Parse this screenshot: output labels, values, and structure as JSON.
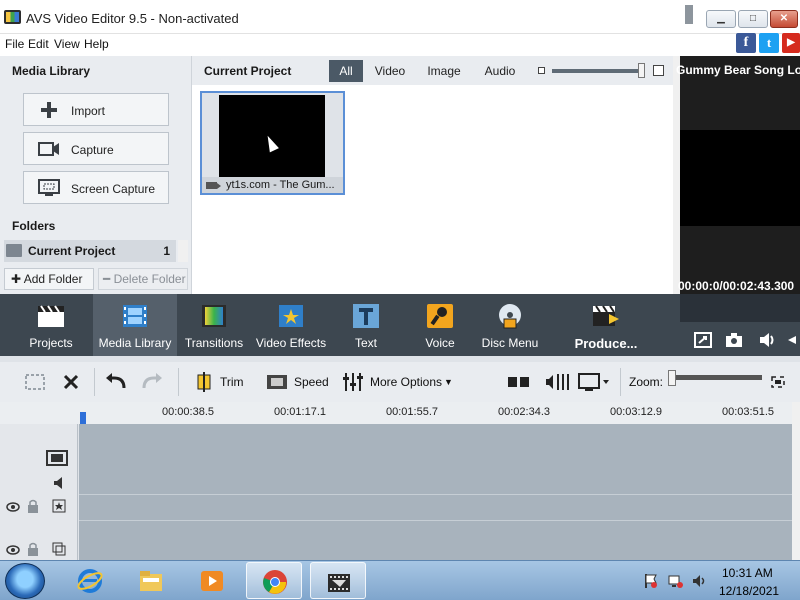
{
  "window": {
    "title": "AVS Video Editor 9.5 - Non-activated",
    "minimize": "▁",
    "maximize": "□",
    "close": "✕"
  },
  "menu": [
    "File",
    "Edit",
    "View",
    "Help"
  ],
  "social": {
    "facebook": "f",
    "twitter": "t",
    "youtube": "▶"
  },
  "media_library": {
    "heading": "Media Library",
    "buttons": [
      "Import",
      "Capture",
      "Screen Capture"
    ],
    "folders_heading": "Folders",
    "folder": {
      "name": "Current Project",
      "count": "1"
    },
    "add_folder": "Add Folder",
    "delete_folder": "Delete Folder"
  },
  "project": {
    "heading": "Current Project",
    "filters": [
      "All",
      "Video",
      "Image",
      "Audio"
    ],
    "active_filter": "All",
    "items": [
      {
        "caption": "yt1s.com - The Gum..."
      }
    ]
  },
  "preview": {
    "title": "Gummy Bear Song  Lor",
    "time": "00:00:0­/00:02:43.300"
  },
  "toolbar": {
    "items": [
      "Projects",
      "Media Library",
      "Transitions",
      "Video Effects",
      "Text",
      "Voice",
      "Disc Menu",
      "Produce..."
    ],
    "active": "Media Library"
  },
  "timeline_toolbar": {
    "trim": "Trim",
    "speed": "Speed",
    "more_options": "More Options",
    "zoom": "Zoom:"
  },
  "ruler": [
    "00:00:38.5",
    "00:01:17.1",
    "00:01:55.7",
    "00:02:34.3",
    "00:03:12.9",
    "00:03:51.5"
  ],
  "taskbar": {
    "time": "10:31 AM",
    "date": "12/18/2021"
  },
  "colors": {
    "toolbar_bg": "#3d4750",
    "selection_border": "#5b8fd6",
    "timeline_bg": "#a8b3bd"
  }
}
